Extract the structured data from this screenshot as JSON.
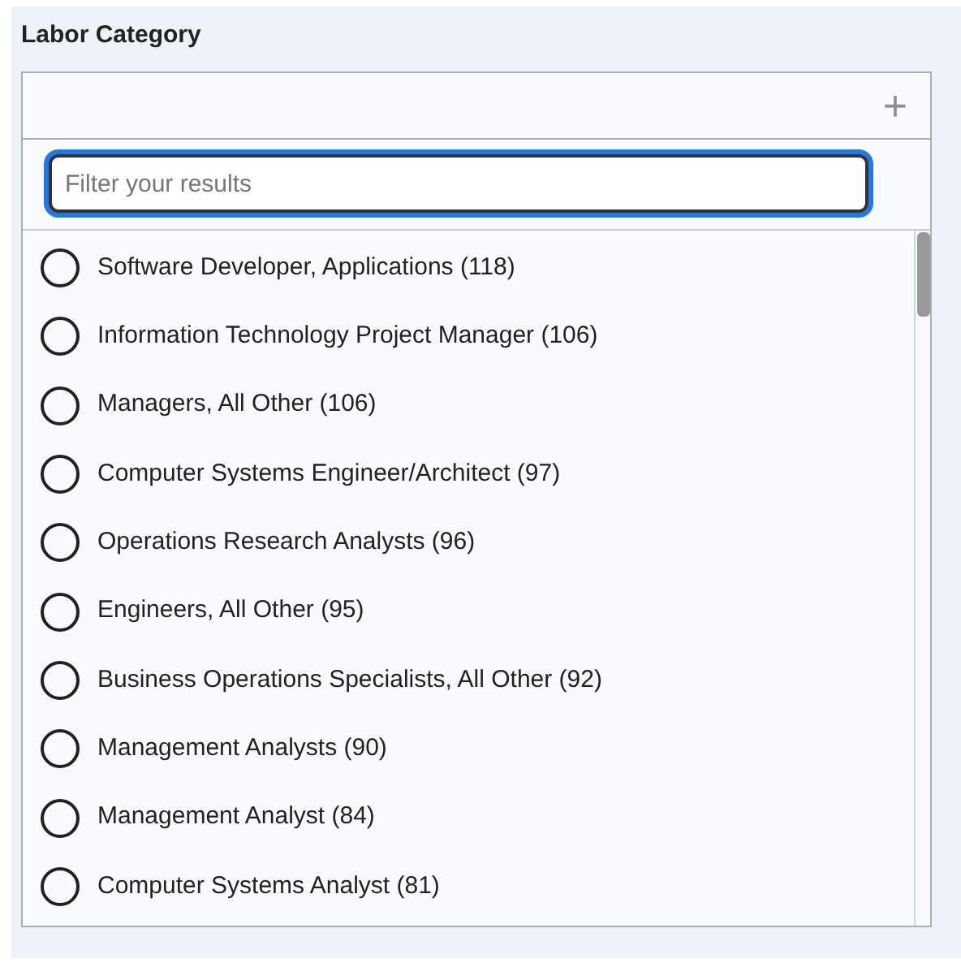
{
  "panel": {
    "title": "Labor Category",
    "add_button": "+"
  },
  "filter": {
    "placeholder": "Filter your results"
  },
  "options": [
    {
      "label": "Software Developer, Applications (118)",
      "selected": false
    },
    {
      "label": "Information Technology Project Manager (106)",
      "selected": false
    },
    {
      "label": "Managers, All Other (106)",
      "selected": false
    },
    {
      "label": "Computer Systems Engineer/Architect (97)",
      "selected": false
    },
    {
      "label": "Operations Research Analysts (96)",
      "selected": false
    },
    {
      "label": "Engineers, All Other (95)",
      "selected": false
    },
    {
      "label": "Business Operations Specialists, All Other (92)",
      "selected": false
    },
    {
      "label": "Management Analysts (90)",
      "selected": false
    },
    {
      "label": "Management Analyst (84)",
      "selected": false
    },
    {
      "label": "Computer Systems Analyst (81)",
      "selected": false
    }
  ]
}
